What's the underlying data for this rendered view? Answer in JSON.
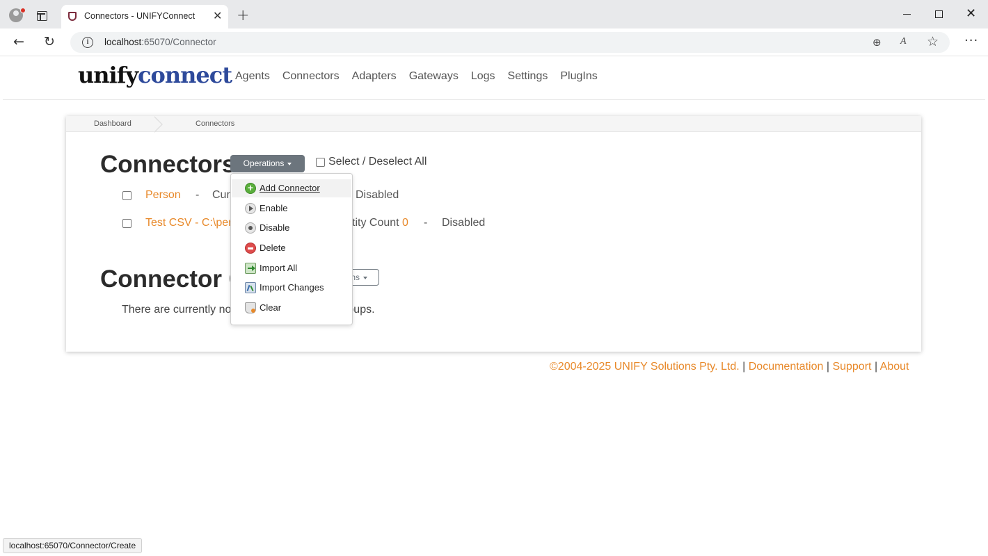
{
  "browser": {
    "tab_title": "Connectors - UNIFYConnect",
    "tab_close": "✕",
    "new_tab": "+",
    "url_host": "localhost",
    "url_path": ":65070/Connector",
    "status_url": "localhost:65070/Connector/Create"
  },
  "site": {
    "logo_part1": "unify",
    "logo_part2": "connect",
    "nav": [
      "Agents",
      "Connectors",
      "Adapters",
      "Gateways",
      "Logs",
      "Settings",
      "PlugIns"
    ]
  },
  "breadcrumb": [
    "Dashboard",
    "Connectors"
  ],
  "connectors_section": {
    "title": "Connectors",
    "operations_label": "Operations",
    "select_all_label": "Select / Deselect All",
    "rows": [
      {
        "name": "Person",
        "sep1": "-",
        "mid": "Cur",
        "status": "Disabled"
      },
      {
        "name": "Test CSV - C:\\per",
        "mid": "tity Count",
        "count": "0",
        "sep2": "-",
        "status": "Disabled"
      }
    ]
  },
  "operations_menu": {
    "items": [
      "Add Connector",
      "Enable",
      "Disable",
      "Delete",
      "Import All",
      "Import Changes",
      "Clear"
    ]
  },
  "groups_section": {
    "title": "Connector G",
    "operations_label": "ns",
    "empty_text_left": "There are currently no",
    "empty_text_right": "oups."
  },
  "footer": {
    "copyright": "©2004-2025 UNIFY Solutions Pty. Ltd.",
    "sep": "|",
    "documentation": "Documentation",
    "support": "Support",
    "about": "About"
  },
  "colors": {
    "accent_orange": "#e8892a",
    "logo_blue": "#2e4a9b",
    "button_gray": "#6c757d"
  }
}
